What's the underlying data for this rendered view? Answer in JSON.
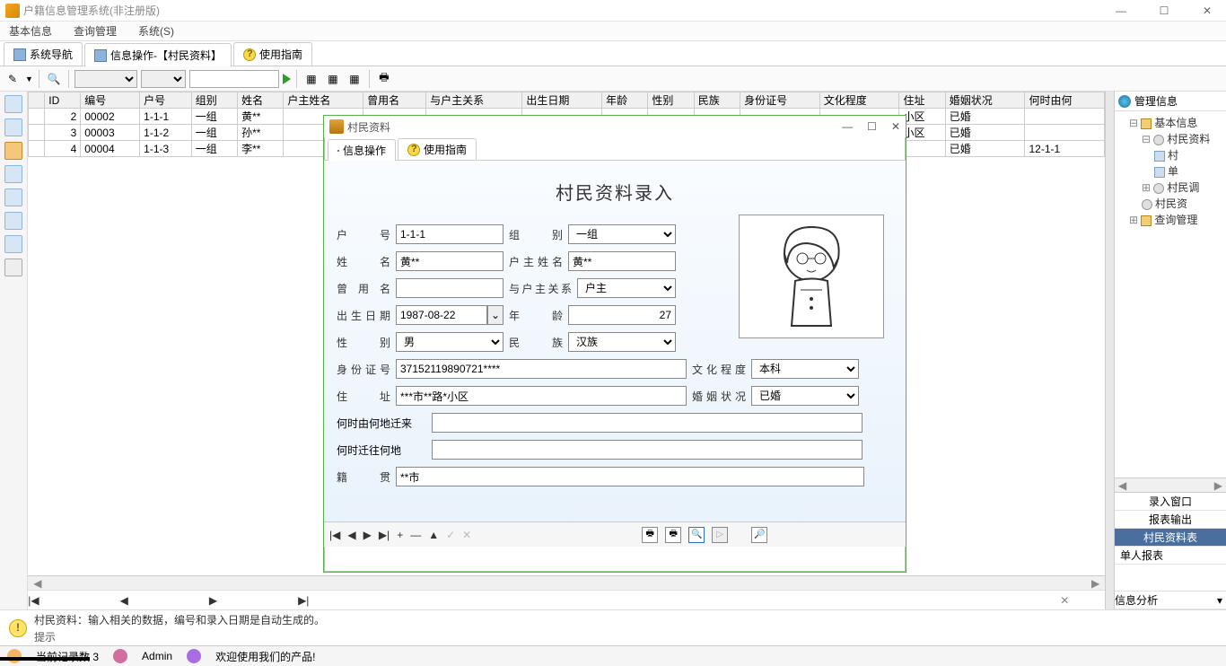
{
  "app": {
    "title": "户籍信息管理系统(非注册版)"
  },
  "menu": {
    "basic": "基本信息",
    "query": "查询管理",
    "system": "系统(S)"
  },
  "tabs": {
    "nav": "系统导航",
    "info": "信息操作-【村民资料】",
    "guide": "使用指南"
  },
  "table": {
    "headers": [
      "ID",
      "编号",
      "户号",
      "组别",
      "姓名",
      "户主姓名",
      "曾用名",
      "与户主关系",
      "出生日期",
      "年龄",
      "性别",
      "民族",
      "身份证号",
      "文化程度",
      "住址",
      "婚姻状况",
      "何时由何"
    ],
    "rows": [
      {
        "id": "2",
        "code": "00002",
        "huno": "1-1-1",
        "group": "一组",
        "name": "黄**",
        "addr_tail": "小区",
        "marriage": "已婚",
        "migrate": ""
      },
      {
        "id": "3",
        "code": "00003",
        "huno": "1-1-2",
        "group": "一组",
        "name": "孙**",
        "addr_tail": "小区",
        "marriage": "已婚",
        "migrate": ""
      },
      {
        "id": "4",
        "code": "00004",
        "huno": "1-1-3",
        "group": "一组",
        "name": "李**",
        "addr_tail": "",
        "marriage": "已婚",
        "migrate": "12-1-1"
      }
    ]
  },
  "modal": {
    "title": "村民资料",
    "tab_info": "信息操作",
    "tab_guide": "使用指南",
    "form_title": "村民资料录入",
    "labels": {
      "huno": "户　号",
      "group": "组　别",
      "name": "姓　名",
      "head": "户主姓名",
      "oldname": "曾 用 名",
      "relation": "与户主关系",
      "birth": "出生日期",
      "age": "年　　龄",
      "gender": "性　别",
      "ethnic": "民　　族",
      "idno": "身份证号",
      "edu": "文化程度",
      "addr": "住　址",
      "marriage": "婚姻状况",
      "from": "何时由何地迁来",
      "to": "何时迁往何地",
      "origin": "籍　贯"
    },
    "values": {
      "huno": "1-1-1",
      "group": "一组",
      "name": "黄**",
      "head": "黄**",
      "oldname": "",
      "relation": "户主",
      "birth": "1987-08-22",
      "age": "27",
      "gender": "男",
      "ethnic": "汉族",
      "idno": "37152119890721****",
      "edu": "本科",
      "addr": "***市**路*小区",
      "marriage": "已婚",
      "from": "",
      "to": "",
      "origin": "**市"
    }
  },
  "tree": {
    "title": "管理信息",
    "basic": "基本信息",
    "villager": "村民资料",
    "vill_a": "村",
    "vill_b": "单",
    "survey": "村民调",
    "vill_c": "村民资",
    "query": "查询管理"
  },
  "right_panel": {
    "win": "录入窗口",
    "report": "报表输出",
    "sel": "村民资料表",
    "single": "单人报表",
    "analyze": "信息分析"
  },
  "hint": {
    "label": "提示",
    "text": "村民资料：输入相关的数据，编号和录入日期是自动生成的。"
  },
  "status": {
    "count_label": "当前记录数",
    "count": "3",
    "user": "Admin",
    "welcome": "欢迎使用我们的产品!"
  },
  "nav": {
    "first": "|◀",
    "prev": "◀",
    "next": "▶",
    "last": "▶|",
    "plus": "+",
    "minus": "—",
    "up": "▲",
    "check": "✓",
    "x": "✕"
  }
}
